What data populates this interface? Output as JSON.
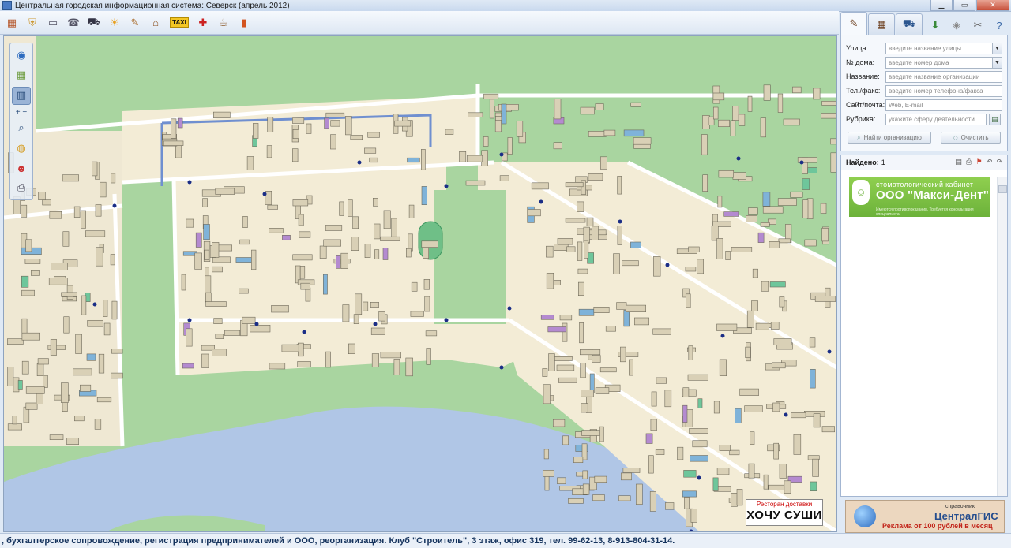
{
  "window": {
    "title": "Центральная городская информационная система:  Северск (апрель 2012)"
  },
  "toolbar": {
    "icons": [
      "city-gis-icon",
      "coat-of-arms-icon",
      "bus-icon",
      "phone-book-icon",
      "transport-icon",
      "weather-icon",
      "pen-edit-icon",
      "house-icon",
      "taxi-icon",
      "medical-icon",
      "cafe-icon",
      "card-icon"
    ],
    "taxi_label": "TAXI"
  },
  "map": {
    "tools": [
      "globe-icon",
      "layers-icon",
      "city-view-icon",
      "zoom-icon",
      "ruler-icon",
      "person-icon",
      "print-icon"
    ],
    "plus": "+",
    "minus": "−",
    "colors": {
      "water": "#b0c6e6",
      "park": "#a9d5a0",
      "quarter": "#f3ecd6",
      "building": "#d9d0b6",
      "road": "#ffffff",
      "stop": "#1a2d86"
    }
  },
  "sushi_ad": {
    "small": "Ресторан доставки",
    "big": "ХОЧУ СУШИ"
  },
  "panel": {
    "tabs": [
      "search-org-icon",
      "map-search-icon",
      "transport-tab-icon"
    ],
    "right_icons": [
      "download-icon",
      "eraser-icon",
      "tools-icon",
      "help-icon"
    ],
    "street_label": "Улица:",
    "street_placeholder": "введите название улицы",
    "house_label": "№ дома:",
    "house_placeholder": "введите номер дома",
    "name_label": "Название:",
    "name_placeholder": "введите название организации",
    "phone_label": "Тел./факс:",
    "phone_placeholder": "введите номер телефона/факса",
    "site_label": "Сайт/почта:",
    "site_placeholder": "Web, E-mail",
    "rubric_label": "Рубрика:",
    "rubric_placeholder": "укажите сферу деятельности",
    "find_button": "Найти организацию",
    "clear_button": "Очистить"
  },
  "results": {
    "found_label": "Найдено:",
    "found_count": "1",
    "ad_line1": "стоматологический кабинет",
    "ad_line2": "ООО \"Макси-Дент\"",
    "ad_line3": "Имеются противопоказания. Требуется консультация специалиста."
  },
  "centralgis": {
    "small": "справочник",
    "brand": "ЦентралГИС",
    "promo": "Реклама от 100 рублей в месяц"
  },
  "ticker": {
    "text": ", бухгалтерское сопровождение, регистрация предпринимателей и ООО, реорганизация. Клуб \"Строитель\", 3 этаж, офис 319, тел. 99-62-13, 8-913-804-31-14."
  }
}
